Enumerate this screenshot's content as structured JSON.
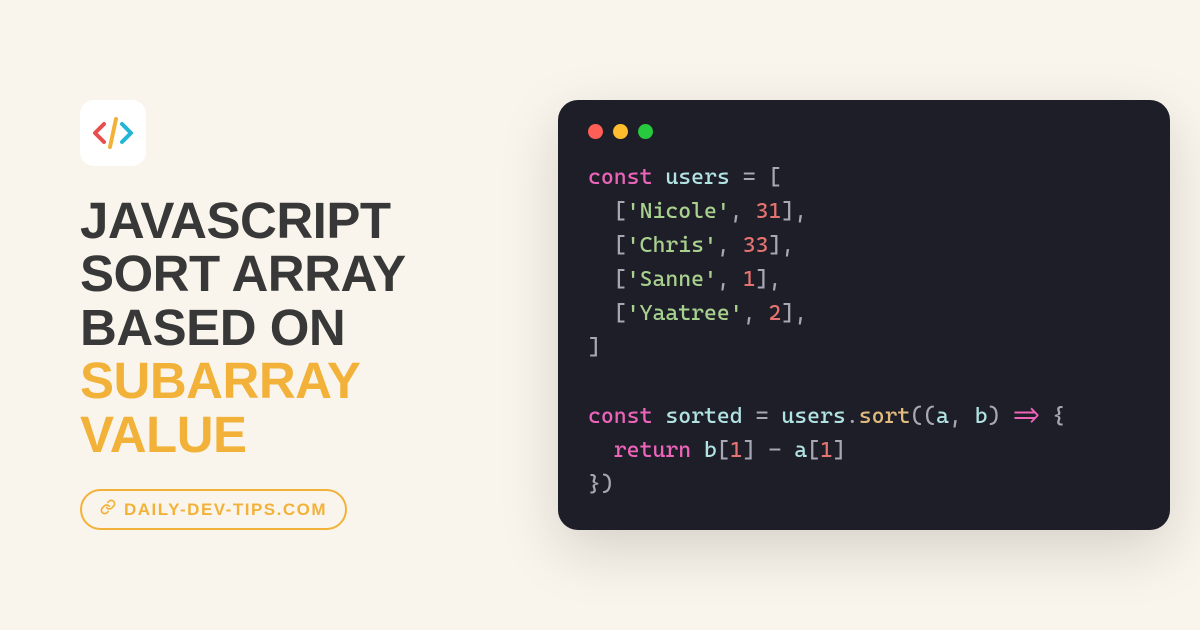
{
  "title": {
    "line1": "JAVASCRIPT",
    "line2": "SORT ARRAY",
    "line3": "BASED ON",
    "line4": "SUBARRAY",
    "line5": "VALUE"
  },
  "badge": {
    "text": "DAILY-DEV-TIPS.COM"
  },
  "code": {
    "kw_const1": "const",
    "var_users": "users",
    "eq": "=",
    "open_bracket": "[",
    "row1_name": "'Nicole'",
    "row1_num": "31",
    "row2_name": "'Chris'",
    "row2_num": "33",
    "row3_name": "'Sanne'",
    "row3_num": "1",
    "row4_name": "'Yaatree'",
    "row4_num": "2",
    "close_bracket": "]",
    "kw_const2": "const",
    "var_sorted": "sorted",
    "eq2": "=",
    "var_users2": "users",
    "dot": ".",
    "method_sort": "sort",
    "open_paren": "((",
    "param_a": "a",
    "comma_ab": ", ",
    "param_b": "b",
    "close_paren_arg": ")",
    "arrow": " => ",
    "open_brace": "{",
    "kw_return": "return",
    "expr_b": "b",
    "idx1": "[",
    "num1": "1",
    "idx1c": "]",
    "minus": " - ",
    "expr_a": "a",
    "idx2": "[",
    "num2": "1",
    "idx2c": "]",
    "close_brace_paren": "})"
  }
}
